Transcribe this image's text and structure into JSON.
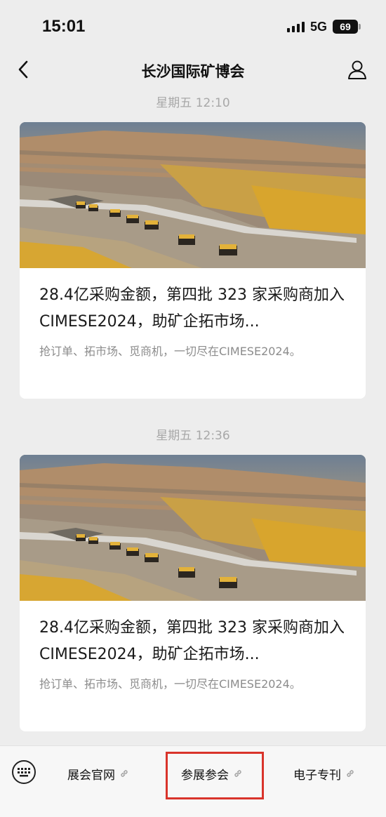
{
  "status_bar": {
    "time": "15:01",
    "network": "5G",
    "battery": "69"
  },
  "nav": {
    "title": "长沙国际矿博会",
    "back_icon": "chevron-left-icon",
    "profile_icon": "person-icon"
  },
  "feed": [
    {
      "timestamp": "星期五 12:10",
      "title": "28.4亿采购金额，第四批 323 家采购商加入 CIMESE2024，助矿企拓市场...",
      "description": "抢订单、拓市场、觅商机，一切尽在CIMESE2024。",
      "image": "open-pit-mine-haul-trucks-photo"
    },
    {
      "timestamp": "星期五 12:36",
      "title": "28.4亿采购金额，第四批 323 家采购商加入 CIMESE2024，助矿企拓市场...",
      "description": "抢订单、拓市场、觅商机，一切尽在CIMESE2024。",
      "image": "open-pit-mine-haul-trucks-photo"
    }
  ],
  "bottom_menu": {
    "keyboard_icon": "keyboard-icon",
    "items": [
      {
        "label": "展会官网",
        "icon": "link-icon"
      },
      {
        "label": "参展参会",
        "icon": "link-icon"
      },
      {
        "label": "电子专刊",
        "icon": "link-icon"
      }
    ],
    "highlight_color": "#d9342b"
  }
}
